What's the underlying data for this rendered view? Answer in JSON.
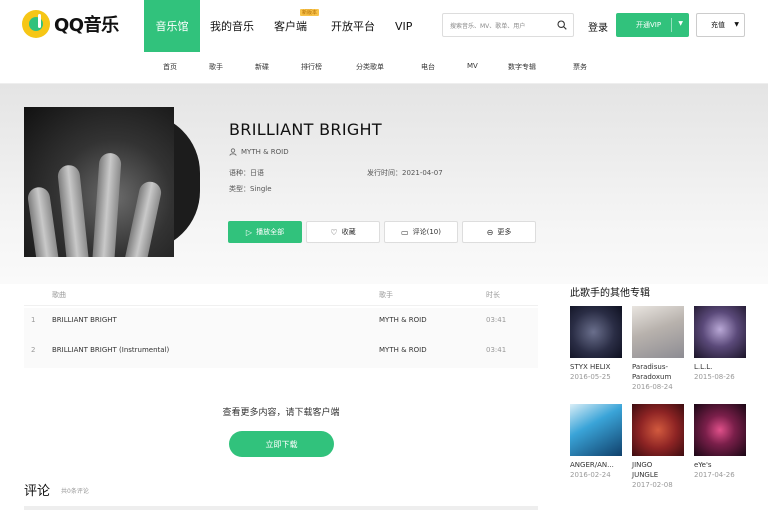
{
  "brand": {
    "name": "QQ音乐"
  },
  "topnav": [
    {
      "label": "音乐馆"
    },
    {
      "label": "我的音乐"
    },
    {
      "label": "客户端",
      "badge": "新版本"
    },
    {
      "label": "开放平台"
    },
    {
      "label": "VIP"
    }
  ],
  "search": {
    "placeholder": "搜索音乐、MV、歌单、用户"
  },
  "header_actions": {
    "login": "登录",
    "vip": "开通VIP",
    "recharge": "充值"
  },
  "subnav": [
    "首页",
    "歌手",
    "新碟",
    "排行榜",
    "分类歌单",
    "电台",
    "MV",
    "数字专辑",
    "票务"
  ],
  "album": {
    "title": "BRILLIANT BRIGHT",
    "artist": "MYTH & ROID",
    "genre": "语种：日语",
    "type": "类型：Single",
    "release": "发行时间：2021-04-07"
  },
  "actions": {
    "play_all": "播放全部",
    "favorite": "收藏",
    "comment": "评论(10)",
    "more": "更多"
  },
  "song_table": {
    "headers": [
      "歌曲",
      "歌手",
      "时长"
    ],
    "rows": [
      {
        "index": "1",
        "title": "BRILLIANT BRIGHT",
        "artist": "MYTH & ROID",
        "duration": "03:41"
      },
      {
        "index": "2",
        "title": "BRILLIANT BRIGHT (Instrumental)",
        "artist": "MYTH & ROID",
        "duration": "03:41"
      }
    ]
  },
  "more_content": "查看更多内容，请下载客户端",
  "download_button": "立即下载",
  "comments": {
    "title": "评论",
    "count": "共0条评论"
  },
  "other_albums": {
    "title": "此歌手的其他专辑",
    "items": [
      {
        "name": "STYX HELIX",
        "date": "2016-05-25"
      },
      {
        "name": "Paradisus-",
        "name2": "Paradoxum",
        "date": "2016-08-24"
      },
      {
        "name": "L.L.L.",
        "date": "2015-08-26"
      },
      {
        "name": "ANGER/AN...",
        "date": "2016-02-24"
      },
      {
        "name": "JINGO",
        "name2": "JUNGLE",
        "date": "2017-02-08"
      },
      {
        "name": "eYe's",
        "date": "2017-04-26"
      }
    ]
  },
  "colors": {
    "accent": "#31c27c",
    "logo_yellow": "#f6c616"
  }
}
